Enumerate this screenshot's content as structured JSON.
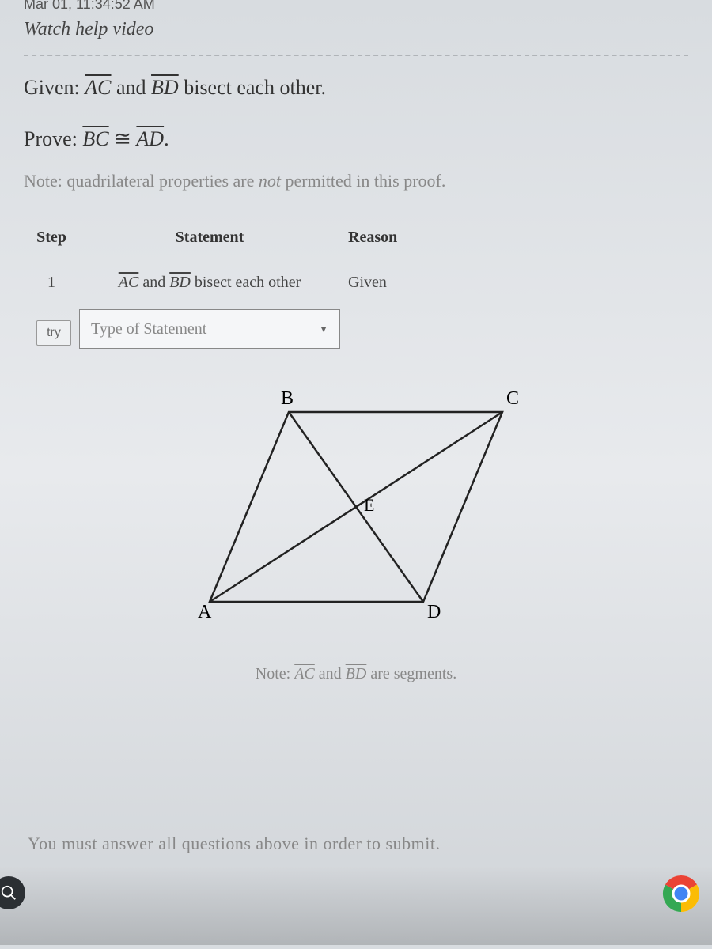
{
  "header": {
    "timestamp": "Mar 01, 11:34:52 AM",
    "watch_link": "Watch help video"
  },
  "problem": {
    "given_label": "Given: ",
    "given_seg1": "AC",
    "given_mid": " and ",
    "given_seg2": "BD",
    "given_rest": " bisect each other.",
    "prove_label": "Prove: ",
    "prove_seg1": "BC",
    "prove_cong": " ≅ ",
    "prove_seg2": "AD",
    "prove_end": ".",
    "note_prefix": "Note: quadrilateral properties are ",
    "note_em": "not",
    "note_suffix": " permitted in this proof."
  },
  "table": {
    "h_step": "Step",
    "h_statement": "Statement",
    "h_reason": "Reason",
    "row1": {
      "step": "1",
      "stmt_seg1": "AC",
      "stmt_mid": " and ",
      "stmt_seg2": "BD",
      "stmt_rest": " bisect each other",
      "reason": "Given"
    },
    "try_label": "try",
    "dropdown_placeholder": "Type of Statement"
  },
  "figure": {
    "labels": {
      "A": "A",
      "B": "B",
      "C": "C",
      "D": "D",
      "E": "E"
    },
    "note_prefix": "Note: ",
    "note_seg1": "AC",
    "note_mid": " and ",
    "note_seg2": "BD",
    "note_suffix": " are segments."
  },
  "footer_msg": "You must answer all questions above in order to submit."
}
